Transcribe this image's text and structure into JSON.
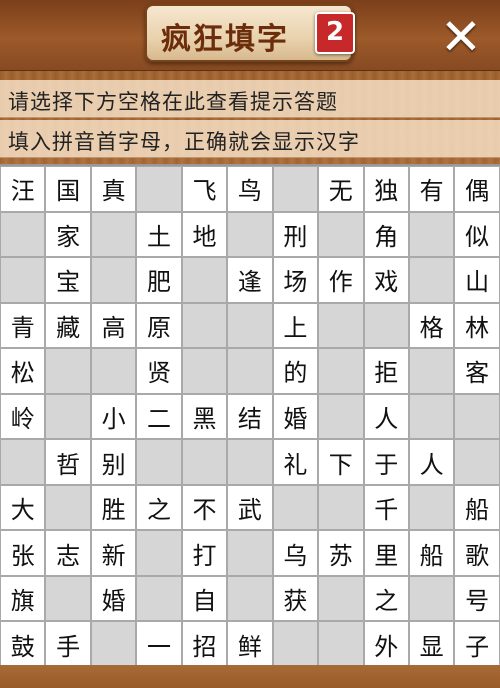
{
  "header": {
    "title": "疯狂填字",
    "badge": "2",
    "close_icon": "close-icon"
  },
  "hints": {
    "line1": "请选择下方空格在此查看提示答题",
    "line2": "填入拼音首字母，正确就会显示汉字"
  },
  "grid": {
    "rows": [
      [
        "汪",
        "国",
        "真",
        "",
        "飞",
        "鸟",
        "",
        "无",
        "独",
        "有",
        "偶"
      ],
      [
        "",
        "家",
        "",
        "土",
        "地",
        "",
        "刑",
        "",
        "角",
        "",
        "似"
      ],
      [
        "",
        "宝",
        "",
        "肥",
        "",
        "逢",
        "场",
        "作",
        "戏",
        "",
        "山"
      ],
      [
        "青",
        "藏",
        "高",
        "原",
        "",
        "",
        "上",
        "",
        "",
        "格",
        "林"
      ],
      [
        "松",
        "",
        "",
        "贤",
        "",
        "",
        "的",
        "",
        "拒",
        "",
        "客"
      ],
      [
        "岭",
        "",
        "小",
        "二",
        "黑",
        "结",
        "婚",
        "",
        "人",
        "",
        ""
      ],
      [
        "",
        "哲",
        "别",
        "",
        "",
        "",
        "礼",
        "下",
        "于",
        "人",
        ""
      ],
      [
        "大",
        "",
        "胜",
        "之",
        "不",
        "武",
        "",
        "",
        "千",
        "",
        "船"
      ],
      [
        "张",
        "志",
        "新",
        "",
        "打",
        "",
        "乌",
        "苏",
        "里",
        "船",
        "歌"
      ],
      [
        "旗",
        "",
        "婚",
        "",
        "自",
        "",
        "获",
        "",
        "之",
        "",
        "号"
      ],
      [
        "鼓",
        "手",
        "",
        "一",
        "招",
        "鲜",
        "",
        "",
        "外",
        "显",
        "子"
      ]
    ]
  }
}
